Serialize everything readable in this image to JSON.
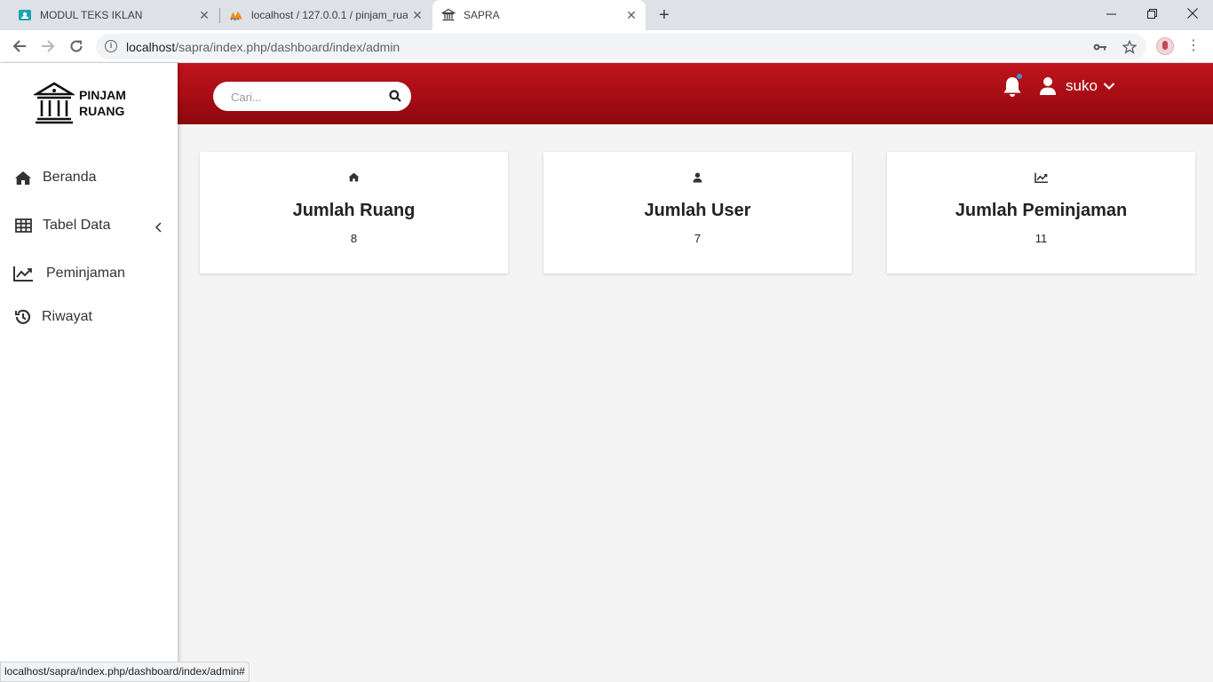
{
  "browser": {
    "tabs": [
      {
        "title": "MODUL TEKS IKLAN",
        "icon": "classroom-icon"
      },
      {
        "title": "localhost / 127.0.0.1 / pinjam_ruang",
        "icon": "phpmyadmin-icon"
      },
      {
        "title": "SAPRA",
        "icon": "bank-icon",
        "active": true
      }
    ],
    "url_host": "localhost",
    "url_path": "/sapra/index.php/dashboard/index/admin",
    "status_url": "localhost/sapra/index.php/dashboard/index/admin#"
  },
  "app": {
    "logo": {
      "line1": "PINJAM",
      "line2": "RUANG"
    },
    "sidebar": {
      "items": [
        {
          "label": "Beranda",
          "icon": "home-icon"
        },
        {
          "label": "Tabel Data",
          "icon": "table-icon"
        },
        {
          "label": "Peminjaman",
          "icon": "chart-line-icon"
        },
        {
          "label": "Riwayat",
          "icon": "history-icon"
        }
      ]
    },
    "topbar": {
      "search_placeholder": "Cari...",
      "username": "suko"
    },
    "cards": [
      {
        "title": "Jumlah Ruang",
        "value": "8",
        "icon": "home-icon"
      },
      {
        "title": "Jumlah User",
        "value": "7",
        "icon": "user-icon"
      },
      {
        "title": "Jumlah Peminjaman",
        "value": "11",
        "icon": "chart-line-icon"
      }
    ],
    "colors": {
      "header_red": "#b0101a",
      "bell_badge": "#3b8ee6"
    }
  }
}
